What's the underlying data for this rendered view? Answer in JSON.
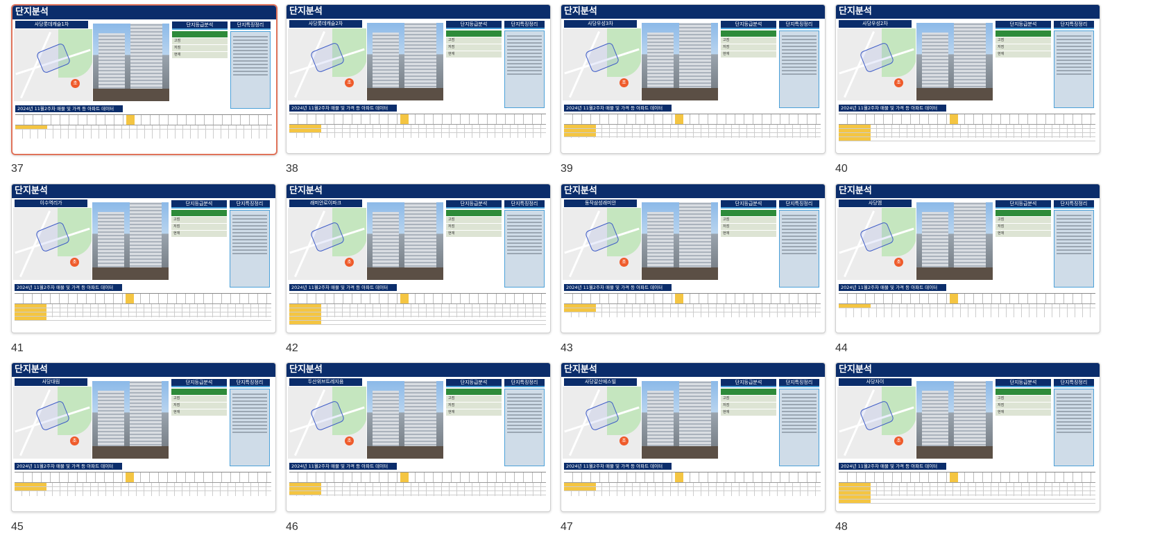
{
  "slides": [
    {
      "number": "37",
      "title": "단지분석",
      "complex": "사당롯데캐슬1차",
      "selected": true,
      "rows": 1
    },
    {
      "number": "38",
      "title": "단지분석",
      "complex": "사당롯데캐슬2차",
      "selected": false,
      "rows": 2
    },
    {
      "number": "39",
      "title": "단지분석",
      "complex": "사당우성3차",
      "selected": false,
      "rows": 3
    },
    {
      "number": "40",
      "title": "단지분석",
      "complex": "사당우성2차",
      "selected": false,
      "rows": 4
    },
    {
      "number": "41",
      "title": "단지분석",
      "complex": "이수역리가",
      "selected": false,
      "rows": 4
    },
    {
      "number": "42",
      "title": "단지분석",
      "complex": "래미안로이파크",
      "selected": false,
      "rows": 5
    },
    {
      "number": "43",
      "title": "단지분석",
      "complex": "동작삼성래미안",
      "selected": false,
      "rows": 2
    },
    {
      "number": "44",
      "title": "단지분석",
      "complex": "사당엠",
      "selected": false,
      "rows": 1
    },
    {
      "number": "45",
      "title": "단지분석",
      "complex": "사당대림",
      "selected": false,
      "rows": 2
    },
    {
      "number": "46",
      "title": "단지분석",
      "complex": "두산위브트레지움",
      "selected": false,
      "rows": 3
    },
    {
      "number": "47",
      "title": "단지분석",
      "complex": "사당갈산에스빌",
      "selected": false,
      "rows": 2
    },
    {
      "number": "48",
      "title": "단지분석",
      "complex": "사당자이",
      "selected": false,
      "rows": 5
    }
  ],
  "labels": {
    "grade_header": "단지등급분석",
    "notes_header": "단지특징정리",
    "data_header": "2024년 11월2주차 매물 및 가격 등 아파트 데이터",
    "grade_rows": [
      "",
      "고점",
      "저점",
      "현재"
    ],
    "pin": "초"
  }
}
